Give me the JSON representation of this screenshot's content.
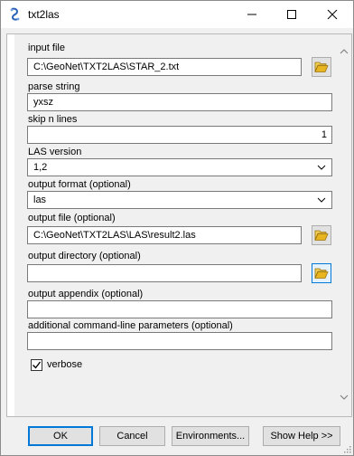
{
  "window": {
    "title": "txt2las"
  },
  "fields": {
    "input_file": {
      "label": "input file",
      "value": "C:\\GeoNet\\TXT2LAS\\STAR_2.txt"
    },
    "parse_string": {
      "label": "parse string",
      "value": "yxsz"
    },
    "skip_n_lines": {
      "label": "skip n lines",
      "value": "1"
    },
    "las_version": {
      "label": "LAS version",
      "value": "1,2"
    },
    "output_format": {
      "label": "output format (optional)",
      "value": "las"
    },
    "output_file": {
      "label": "output file (optional)",
      "value": "C:\\GeoNet\\TXT2LAS\\LAS\\result2.las"
    },
    "output_directory": {
      "label": "output directory (optional)",
      "value": ""
    },
    "output_appendix": {
      "label": "output appendix (optional)",
      "value": ""
    },
    "additional_params": {
      "label": "additional command-line parameters (optional)",
      "value": ""
    }
  },
  "verbose": {
    "label": "verbose",
    "checked": true
  },
  "buttons": {
    "ok": "OK",
    "cancel": "Cancel",
    "environments": "Environments...",
    "show_help": "Show Help >>"
  },
  "icons": {
    "app": "script-icon",
    "browse": "folder-open-icon"
  },
  "colors": {
    "focus_blue": "#0078d7",
    "folder_yellow": "#e8b420"
  }
}
